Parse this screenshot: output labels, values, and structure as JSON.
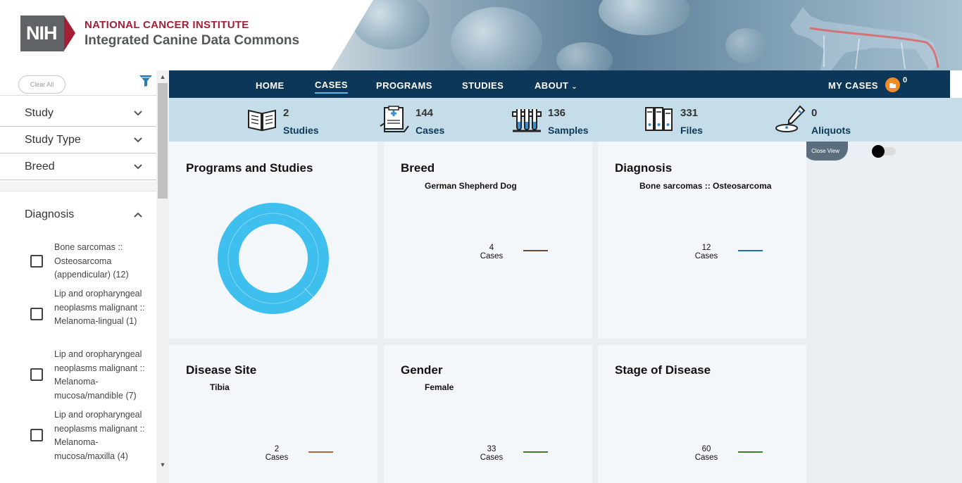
{
  "header": {
    "logo_text": "NIH",
    "org_name": "NATIONAL CANCER INSTITUTE",
    "site_name": "Integrated Canine Data Commons"
  },
  "sidebar": {
    "clear_all": "Clear All",
    "facets": [
      {
        "label": "Study"
      },
      {
        "label": "Study Type"
      },
      {
        "label": "Breed"
      }
    ],
    "diagnosis": {
      "label": "Diagnosis",
      "options": [
        {
          "label": "Bone sarcomas :: Osteosarcoma (appendicular) (12)",
          "checked": false
        },
        {
          "label": "Lip and oropharyngeal neoplasms malignant :: Melanoma-lingual (1)",
          "checked": false
        },
        {
          "label": "Lip and oropharyngeal neoplasms malignant :: Melanoma-mucosa/mandible (7)",
          "checked": false
        },
        {
          "label": "Lip and oropharyngeal neoplasms malignant :: Melanoma-mucosa/maxilla (4)",
          "checked": false
        }
      ]
    }
  },
  "nav": {
    "items": [
      "HOME",
      "CASES",
      "PROGRAMS",
      "STUDIES",
      "ABOUT"
    ],
    "active": "CASES",
    "my_cases_label": "MY CASES",
    "my_cases_count": "0"
  },
  "stats": [
    {
      "count": "2",
      "label": "Studies",
      "icon": "book-icon"
    },
    {
      "count": "144",
      "label": "Cases",
      "icon": "clipboard-icon"
    },
    {
      "count": "136",
      "label": "Samples",
      "icon": "test-tubes-icon"
    },
    {
      "count": "331",
      "label": "Files",
      "icon": "binders-icon"
    },
    {
      "count": "0",
      "label": "Aliquots",
      "icon": "pipette-dish-icon"
    }
  ],
  "dashboard": {
    "close_view": "Close View",
    "toggle_on": false,
    "cards": [
      {
        "title": "Programs and Studies",
        "sub": "",
        "value": "",
        "unit": "",
        "color": "#3fbfee"
      },
      {
        "title": "Breed",
        "sub": "German Shepherd Dog",
        "value": "4",
        "unit": "Cases",
        "color": "#6b4a35"
      },
      {
        "title": "Diagnosis",
        "sub": "Bone sarcomas :: Osteosarcoma",
        "value": "12",
        "unit": "Cases",
        "color": "#1e6fb4"
      },
      {
        "title": "Disease Site",
        "sub": "Tibia",
        "value": "2",
        "unit": "Cases",
        "color": "#b4683a"
      },
      {
        "title": "Gender",
        "sub": "Female",
        "value": "33",
        "unit": "Cases",
        "color": "#3f7d2b"
      },
      {
        "title": "Stage of Disease",
        "sub": "",
        "value": "60",
        "unit": "Cases",
        "color": "#3f7d2b"
      }
    ]
  }
}
